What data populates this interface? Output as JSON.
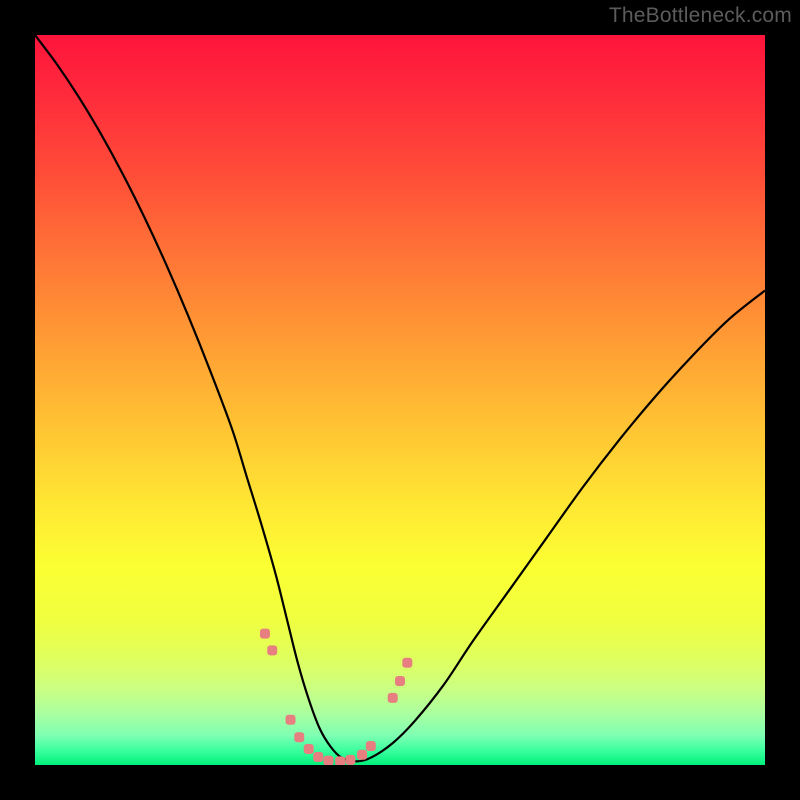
{
  "watermark": "TheBottleneck.com",
  "colors": {
    "background": "#000000",
    "gradient_top": "#ff143c",
    "gradient_mid": "#ffe933",
    "gradient_bottom": "#00f07a",
    "curve": "#000000",
    "markers": "#e77f80"
  },
  "chart_data": {
    "type": "line",
    "title": "",
    "xlabel": "",
    "ylabel": "",
    "xlim": [
      0,
      100
    ],
    "ylim": [
      0,
      100
    ],
    "x": [
      0,
      3,
      6,
      9,
      12,
      15,
      18,
      21,
      24,
      27,
      29,
      31,
      33,
      34.5,
      36,
      37.5,
      39,
      40.5,
      42,
      44,
      46,
      49,
      52,
      56,
      60,
      65,
      70,
      75,
      80,
      85,
      90,
      95,
      100
    ],
    "values": [
      100,
      96,
      91.5,
      86.5,
      81,
      75,
      68.5,
      61.5,
      54,
      46,
      39.5,
      33,
      26,
      20,
      14,
      9,
      5,
      2.5,
      1,
      0.5,
      1,
      3,
      6,
      11,
      17,
      24,
      31,
      38,
      44.5,
      50.5,
      56,
      61,
      65
    ],
    "markers": [
      {
        "x": 31.5,
        "y": 18
      },
      {
        "x": 32.5,
        "y": 15.7
      },
      {
        "x": 35.0,
        "y": 6.2
      },
      {
        "x": 36.2,
        "y": 3.8
      },
      {
        "x": 37.5,
        "y": 2.2
      },
      {
        "x": 38.8,
        "y": 1.1
      },
      {
        "x": 40.2,
        "y": 0.6
      },
      {
        "x": 41.8,
        "y": 0.5
      },
      {
        "x": 43.2,
        "y": 0.7
      },
      {
        "x": 44.8,
        "y": 1.4
      },
      {
        "x": 46.0,
        "y": 2.6
      },
      {
        "x": 49.0,
        "y": 9.2
      },
      {
        "x": 50.0,
        "y": 11.5
      },
      {
        "x": 51.0,
        "y": 14.0
      }
    ],
    "legend": false,
    "grid": false
  }
}
